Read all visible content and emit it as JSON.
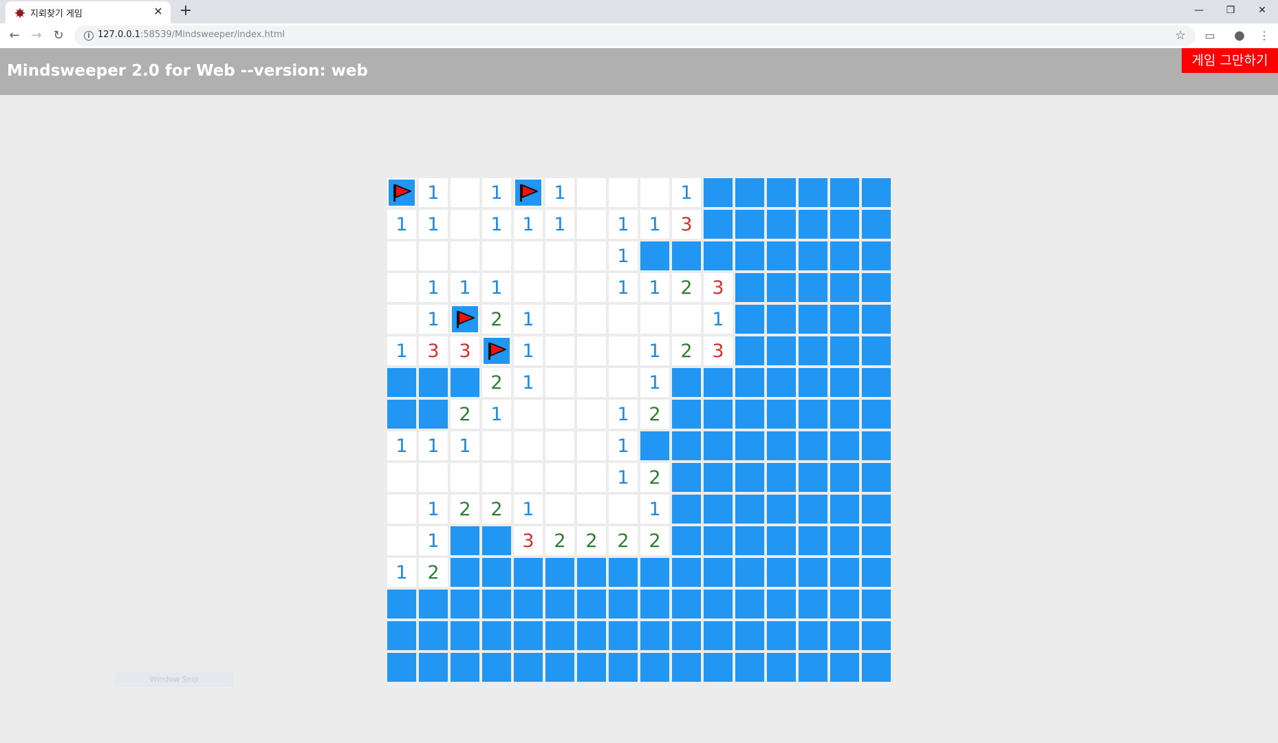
{
  "browser": {
    "tab_title": "지뢰찾기 게임",
    "url_host": "127.0.0.1",
    "url_rest": ":58539/Mindsweeper/index.html"
  },
  "app": {
    "title": "Mindsweeper 2.0 for Web --version: web",
    "quit_label": "게임 그만하기"
  },
  "snip_label": "Window Snip",
  "colors": {
    "hidden": "#2196f3",
    "open": "#ffffff",
    "quit": "#ff0000",
    "n1": "#1e88e5",
    "n2": "#2e7d32",
    "n3": "#d32f2f"
  },
  "legend": {
    "#": "hidden",
    "F": "flag",
    ".": "open-empty",
    "1-8": "open-number"
  },
  "board": [
    "F1.1F1...1######",
    "11.111.113######",
    ".......1########",
    ".111...1123#####",
    ".1F21.....1#####",
    "133F1...123#####",
    "###21...1#######",
    "##21...12#######",
    "111....1########",
    ".......12#######",
    ".1221...1#######",
    ".1##32222#######",
    "12##############",
    "################",
    "################",
    "################"
  ]
}
